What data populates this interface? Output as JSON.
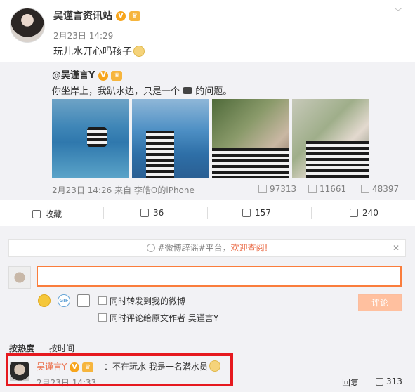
{
  "post": {
    "author": "吴谨言资讯站",
    "time": "2月23日 14:29",
    "text": "玩儿水开心吗孩子"
  },
  "repost": {
    "author": "@吴谨言Y",
    "text_before": "你坐岸上，我趴水边，只是一个",
    "text_after": "的问题。",
    "meta": "2月23日 14:26 来自 李皓O的iPhone",
    "share_count": "97313",
    "comment_count": "11661",
    "like_count": "48397"
  },
  "actions": {
    "favorite": "收藏",
    "forward": "36",
    "comment": "157",
    "like": "240"
  },
  "notice": {
    "prefix": "#微博辟谣#平台，",
    "link": "欢迎查阅!",
    "close": "✕"
  },
  "composer": {
    "placeholder": "",
    "option_forward": "同时转发到我的微博",
    "option_comment_author": "同时评论给原文作者 吴谨言Y",
    "submit": "评论"
  },
  "sort": {
    "by_heat": "按热度",
    "by_time": "按时间"
  },
  "comment": {
    "name": "吴谨言Y",
    "text": "：不在玩水 我是一名潜水员",
    "time": "2月23日 14:33",
    "reply": "回复",
    "likes": "313"
  },
  "badges": {
    "verified": "V",
    "crown": "♛"
  },
  "colors": {
    "accent": "#eb7350",
    "highlight_border": "#e6191f",
    "input_border": "#fa7d3c"
  }
}
